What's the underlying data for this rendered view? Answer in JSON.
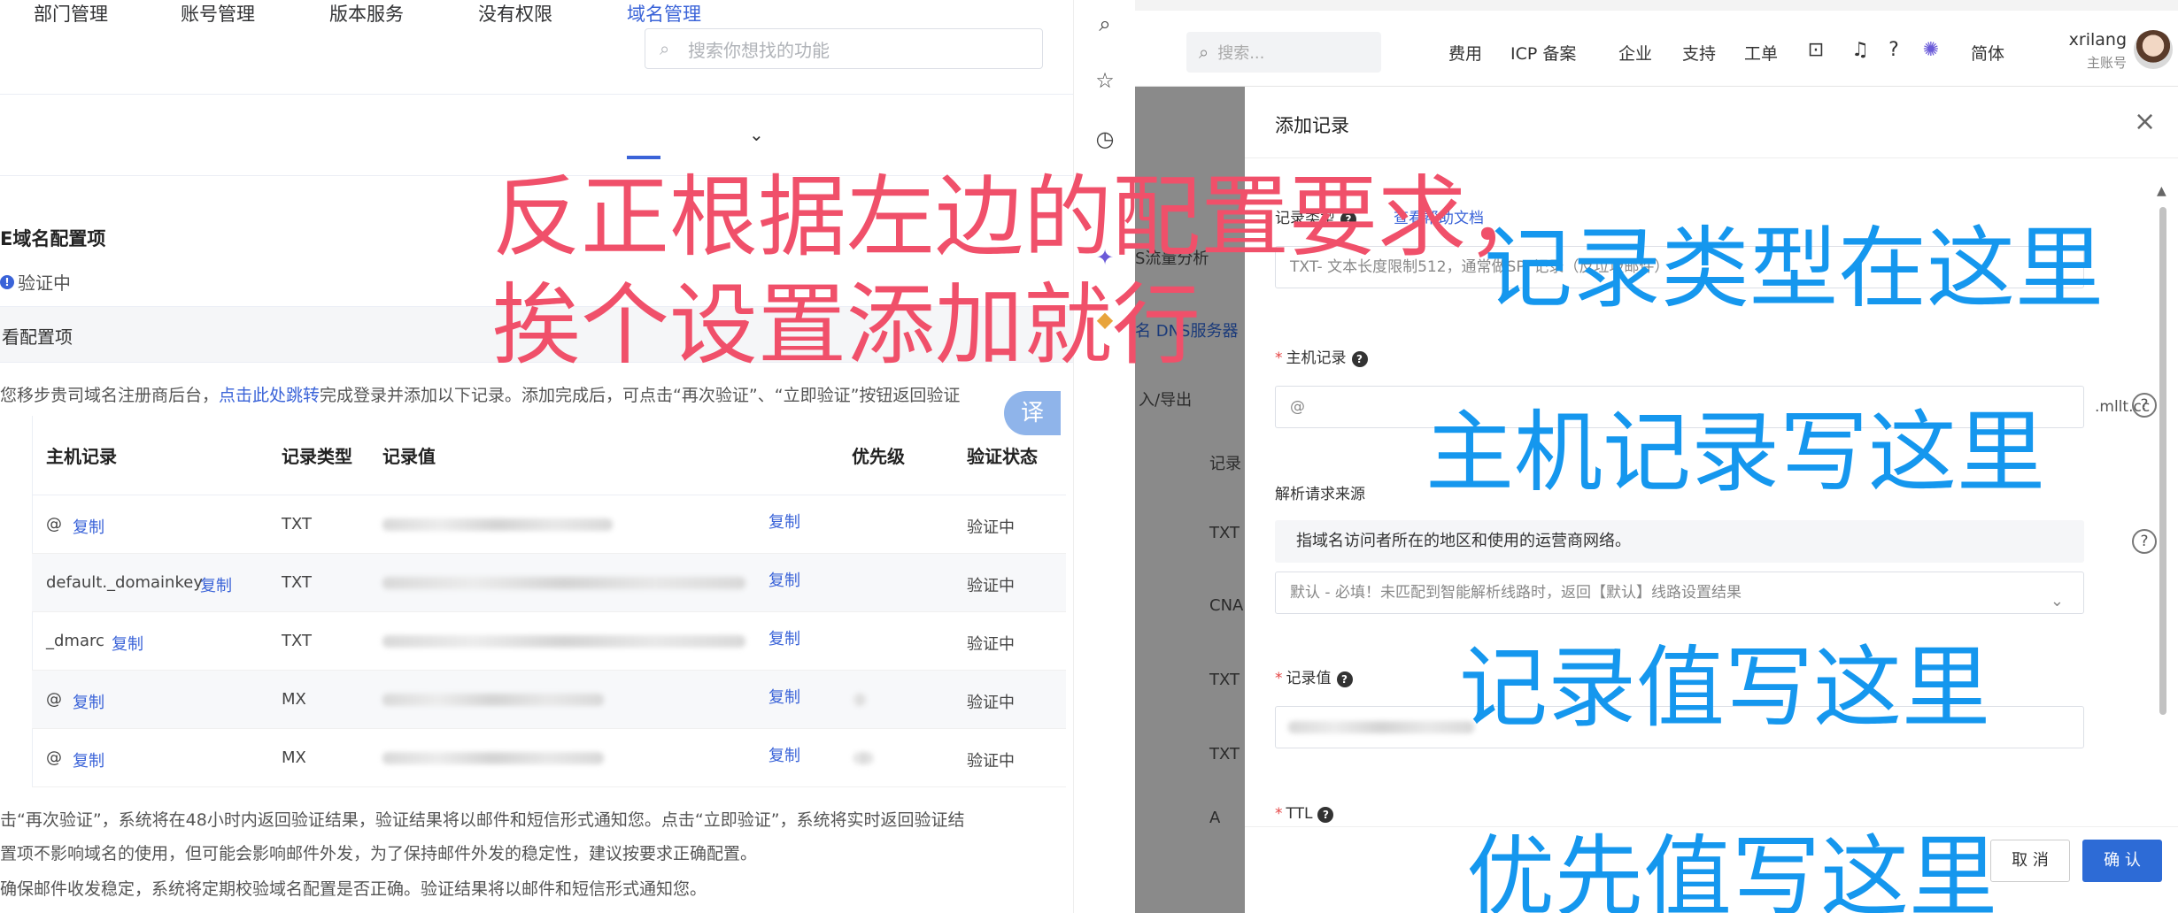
{
  "left": {
    "search_placeholder": "搜索你想找的功能",
    "tabs": [
      {
        "label": "部门管理"
      },
      {
        "label": "账号管理"
      },
      {
        "label": "版本服务"
      },
      {
        "label": "没有权限"
      },
      {
        "label": "域名管理",
        "active": true
      }
    ],
    "section_title": "E域名配置项",
    "verify_status": "验证中",
    "view_config": "看配置项",
    "instruction_pre": "您移步贵司域名注册商后台，",
    "instruction_link": "点击此处跳转",
    "instruction_post": "完成登录并添加以下记录。添加完成后，可点击“再次验证”、“立即验证”按钮返回验证",
    "translate_label": "译",
    "table": {
      "headers": [
        "主机记录",
        "记录类型",
        "记录值",
        "优先级",
        "验证状态"
      ],
      "copy_label": "复制",
      "rows": [
        {
          "host": "@",
          "type": "TXT",
          "status": "验证中"
        },
        {
          "host": "default._domainkey",
          "type": "TXT",
          "status": "验证中"
        },
        {
          "host": "_dmarc",
          "type": "TXT",
          "status": "验证中"
        },
        {
          "host": "@",
          "type": "MX",
          "status": "验证中"
        },
        {
          "host": "@",
          "type": "MX",
          "status": "验证中"
        }
      ]
    },
    "footer_lines": [
      "击“再次验证”，系统将在48小时内返回验证结果，验证结果将以邮件和短信形式通知您。点击“立即验证”，系统将实时返回验证结",
      "置项不影响域名的使用，但可能会影响邮件外发，为了保持邮件外发的稳定性，建议按要求正确配置。",
      "确保邮件收发稳定，系统将定期校验域名配置是否正确。验证结果将以邮件和短信形式通知您。"
    ]
  },
  "strip_icons": [
    "search-icon",
    "star-icon",
    "history-icon",
    "game-icon",
    "bookmark-icon"
  ],
  "right": {
    "search_placeholder": "搜索...",
    "nav": [
      "费用",
      "ICP 备案",
      "企业",
      "支持",
      "工单"
    ],
    "lang": "简体",
    "user_name": "xrilang",
    "user_role": "主账号",
    "bg_texts": {
      "dns_analysis": "S流量分析",
      "dns_server": "名 DNS服务器",
      "import_export": "入/导出",
      "record_col": "记录",
      "rows": [
        "TXT",
        "CNA",
        "TXT",
        "TXT",
        "A"
      ]
    },
    "dialog": {
      "title": "添加记录",
      "record_type_label": "记录类型",
      "help_link": "查看帮助文档",
      "record_type_value": "TXT- 文本长度限制512，通常做SPF记录（反垃圾邮件）",
      "host_label": "主机记录",
      "host_value": "@",
      "host_suffix": ".mllt.cc",
      "source_label": "解析请求来源",
      "source_hint": "指域名访问者所在的地区和使用的运营商网络。",
      "source_value": "默认 - 必填！未匹配到智能解析线路时，返回【默认】线路设置结果",
      "value_label": "记录值",
      "ttl_label": "TTL",
      "cancel": "取 消",
      "confirm": "确 认"
    }
  },
  "annotations": {
    "red_line1": "反正根据左边的配置要求，",
    "red_line2": "挨个设置添加就行",
    "blue_type": "记录类型在这里",
    "blue_host": "主机记录写这里",
    "blue_value": "记录值写这里",
    "blue_priority": "优先值写这里"
  },
  "colors": {
    "accent_blue": "#3a63d8",
    "annotation_red": "#f0506a",
    "annotation_blue": "#1597ee",
    "confirm_button": "#2d6bd6"
  }
}
